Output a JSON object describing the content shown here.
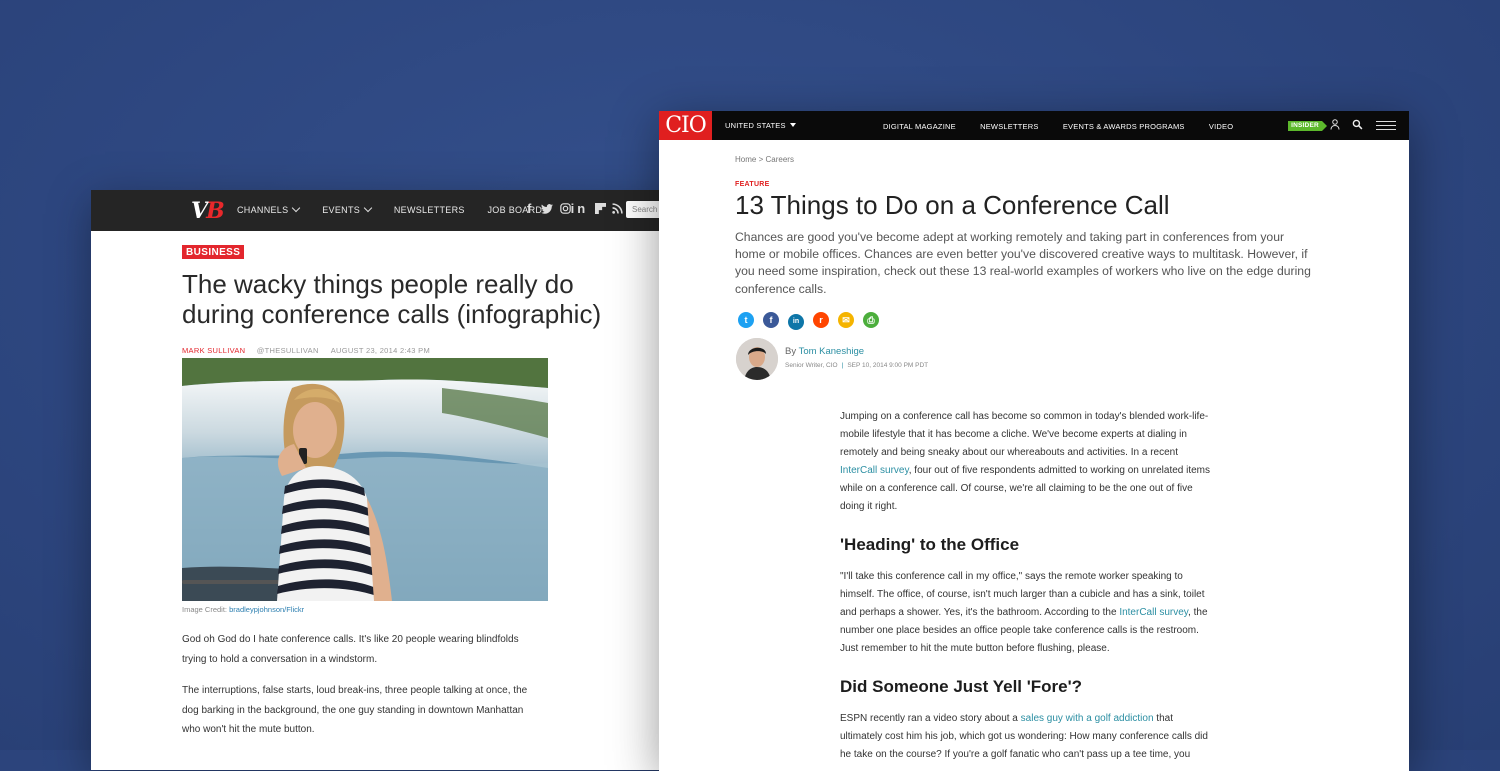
{
  "vb": {
    "logo": {
      "v": "V",
      "b": "B"
    },
    "nav": {
      "channels": "CHANNELS",
      "events": "EVENTS",
      "newsletters": "NEWSLETTERS",
      "job_board": "JOB BOARD"
    },
    "social_icons": [
      "facebook-icon",
      "twitter-icon",
      "instagram-icon",
      "linkedin-icon",
      "flipboard-icon",
      "rss-icon"
    ],
    "search_placeholder": "Search",
    "badge": "BUSINESS",
    "title": "The wacky things people really do during conference calls (infographic)",
    "meta": {
      "author": "MARK SULLIVAN",
      "handle": "@THESULLIVAN",
      "date": "AUGUST 23, 2014 2:43 PM"
    },
    "caption": {
      "label": "Image Credit:",
      "credit": "bradleypjohnson/Flickr"
    },
    "paragraphs": [
      "God oh God do I hate conference calls. It's like 20 people wearing blindfolds trying to hold a conversation in a windstorm.",
      "The interruptions, false starts, loud break-ins, three people talking at once, the dog barking in the background, the one guy standing in downtown Manhattan who won't hit the mute button."
    ]
  },
  "cio": {
    "logo": "CIO",
    "region": "UNITED STATES",
    "nav": {
      "digital_magazine": "DIGITAL MAGAZINE",
      "newsletters": "NEWSLETTERS",
      "events": "EVENTS & AWARDS PROGRAMS",
      "video": "VIDEO"
    },
    "insider": "INSIDER",
    "breadcrumb": {
      "home": "Home",
      "sep": ">",
      "careers": "Careers"
    },
    "kicker": "FEATURE",
    "title": "13 Things to Do on a Conference Call",
    "dek": "Chances are good you've become adept at working remotely and taking part in conferences from your home or mobile offices. Chances are even better you've discovered creative ways to multitask. However, if you need some inspiration, check out these 13 real-world examples of workers who live on the edge during conference calls.",
    "share": [
      {
        "icon": "twitter-icon",
        "color": "#1da1f2",
        "glyph": "t"
      },
      {
        "icon": "facebook-icon",
        "color": "#3b5998",
        "glyph": "f"
      },
      {
        "icon": "linkedin-icon",
        "color": "#0e76a8",
        "glyph": "in"
      },
      {
        "icon": "reddit-icon",
        "color": "#ff4500",
        "glyph": "r"
      },
      {
        "icon": "email-icon",
        "color": "#f5b400",
        "glyph": "✉"
      },
      {
        "icon": "print-icon",
        "color": "#4cae3c",
        "glyph": "⎙"
      }
    ],
    "byline": {
      "by": "By",
      "author": "Tom Kaneshige",
      "role": "Senior Writer, CIO",
      "sep": "|",
      "date": "SEP 10, 2014 9:00 PM PDT"
    },
    "article": {
      "p1_a": "Jumping on a conference call has become so common in today's blended work-life-mobile lifestyle that it has become a cliche. We've become experts at dialing in remotely and being sneaky about our whereabouts and activities. In a recent ",
      "p1_link": "InterCall survey",
      "p1_b": ", four out of five respondents admitted to working on unrelated items while on a conference call. Of course, we're all claiming to be the one out of five doing it right.",
      "h1": "'Heading' to the Office",
      "p2_a": "\"I'll take this conference call in my office,\" says the remote worker speaking to himself. The office, of course, isn't much larger than a cubicle and has a sink, toilet and perhaps a shower. Yes, it's the bathroom. According to the ",
      "p2_link": "InterCall survey",
      "p2_b": ", the number one place besides an office people take conference calls is the restroom. Just remember to hit the mute button before flushing, please.",
      "h2": "Did Someone Just Yell 'Fore'?",
      "p3_a": "ESPN recently ran a video story about a ",
      "p3_link": "sales guy with a golf addiction",
      "p3_b": " that ultimately cost him his job, which got us wondering: How many conference calls did he take on the course? If you're a golf fanatic who can't pass up a tee time, you"
    }
  }
}
